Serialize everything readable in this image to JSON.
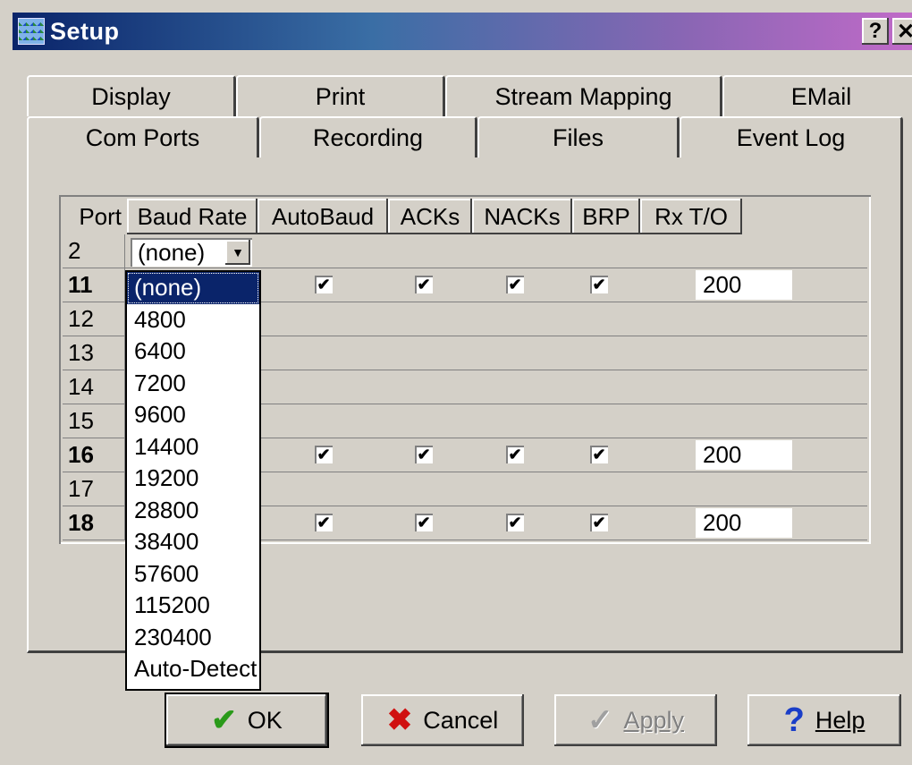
{
  "window": {
    "title": "Setup",
    "help_glyph": "?",
    "close_glyph": "✕"
  },
  "tabs": {
    "back_row": [
      "Display",
      "Print",
      "Stream Mapping",
      "EMail"
    ],
    "front_row": [
      "Com Ports",
      "Recording",
      "Files",
      "Event Log"
    ],
    "active": "Com Ports"
  },
  "grid": {
    "columns": [
      "Port",
      "Baud Rate",
      "AutoBaud",
      "ACKs",
      "NACKs",
      "BRP",
      "Rx T/O"
    ],
    "rows": [
      {
        "port": "2",
        "bold": false,
        "checked": false,
        "rx": ""
      },
      {
        "port": "11",
        "bold": true,
        "checked": true,
        "rx": "200"
      },
      {
        "port": "12",
        "bold": false,
        "checked": false,
        "rx": ""
      },
      {
        "port": "13",
        "bold": false,
        "checked": false,
        "rx": ""
      },
      {
        "port": "14",
        "bold": false,
        "checked": false,
        "rx": ""
      },
      {
        "port": "15",
        "bold": false,
        "checked": false,
        "rx": ""
      },
      {
        "port": "16",
        "bold": true,
        "checked": true,
        "rx": "200"
      },
      {
        "port": "17",
        "bold": false,
        "checked": false,
        "rx": ""
      },
      {
        "port": "18",
        "bold": true,
        "checked": true,
        "rx": "200"
      }
    ],
    "check_glyph": "✔"
  },
  "baud_combo": {
    "value": "(none)",
    "arrow_glyph": "▼",
    "options": [
      "(none)",
      "4800",
      "6400",
      "7200",
      "9600",
      "14400",
      "19200",
      "28800",
      "38400",
      "57600",
      "115200",
      "230400",
      "Auto-Detect"
    ],
    "selected_index": 0
  },
  "buttons": {
    "ok": {
      "label": "OK",
      "icon": "check-icon",
      "glyph": "✔"
    },
    "cancel": {
      "label": "Cancel",
      "icon": "x-icon",
      "glyph": "✖"
    },
    "apply": {
      "label": "Apply",
      "icon": "apply-check-icon",
      "glyph": "✓"
    },
    "help": {
      "label": "Help",
      "icon": "question-icon",
      "glyph": "?"
    }
  },
  "colors": {
    "titlebar_start": "#0a246a",
    "titlebar_end": "#c06ac8",
    "selection": "#0a246a",
    "face": "#d4d0c8"
  }
}
